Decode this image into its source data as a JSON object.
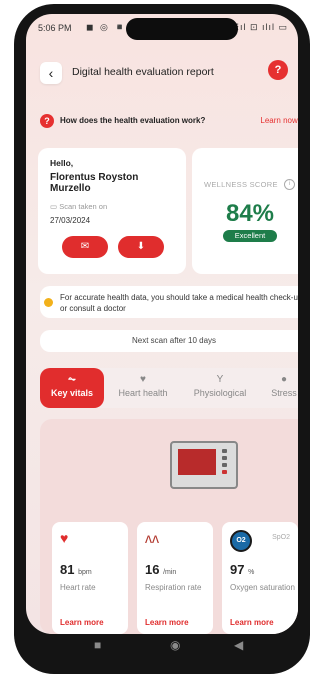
{
  "status_bar": {
    "time": "5:06 PM",
    "left_icons": "◼ ◎ ◾",
    "right_icons": "⊡ ☰ıl ⊡ ılıl ▭"
  },
  "header": {
    "title": "Digital health evaluation report",
    "back_icon": "‹",
    "help_icon": "?"
  },
  "how_it_works": {
    "question": "How does the health evaluation work?",
    "link": "Learn now →"
  },
  "user_card": {
    "greeting": "Hello,",
    "name": "Florentus Royston Murzello",
    "scan_label": "Scan taken on",
    "scan_date": "27/03/2024"
  },
  "wellness": {
    "label": "WELLNESS SCORE",
    "score": "84%",
    "status": "Excellent",
    "color": "#1e7d4a"
  },
  "notice": {
    "text": "For accurate health data, you should take a medical health check-up or consult a doctor"
  },
  "next_scan": "Next scan after 10 days",
  "tabs": [
    {
      "label": "Key vitals",
      "icon": "pulse-icon",
      "active": true
    },
    {
      "label": "Heart health",
      "icon": "heart-icon",
      "active": false
    },
    {
      "label": "Physiological",
      "icon": "physio-icon",
      "active": false
    },
    {
      "label": "Stress",
      "icon": "stress-icon",
      "active": false
    }
  ],
  "vitals": [
    {
      "value": "81",
      "unit": "bpm",
      "label": "Heart rate",
      "link": "Learn more"
    },
    {
      "value": "16",
      "unit": "/min",
      "label": "Respiration rate",
      "link": "Learn more"
    },
    {
      "value": "97",
      "unit": "%",
      "label": "Oxygen saturation",
      "link": "Learn more",
      "tag": "SpO2",
      "badge": "O2"
    }
  ],
  "accent_color": "#e02d2d"
}
